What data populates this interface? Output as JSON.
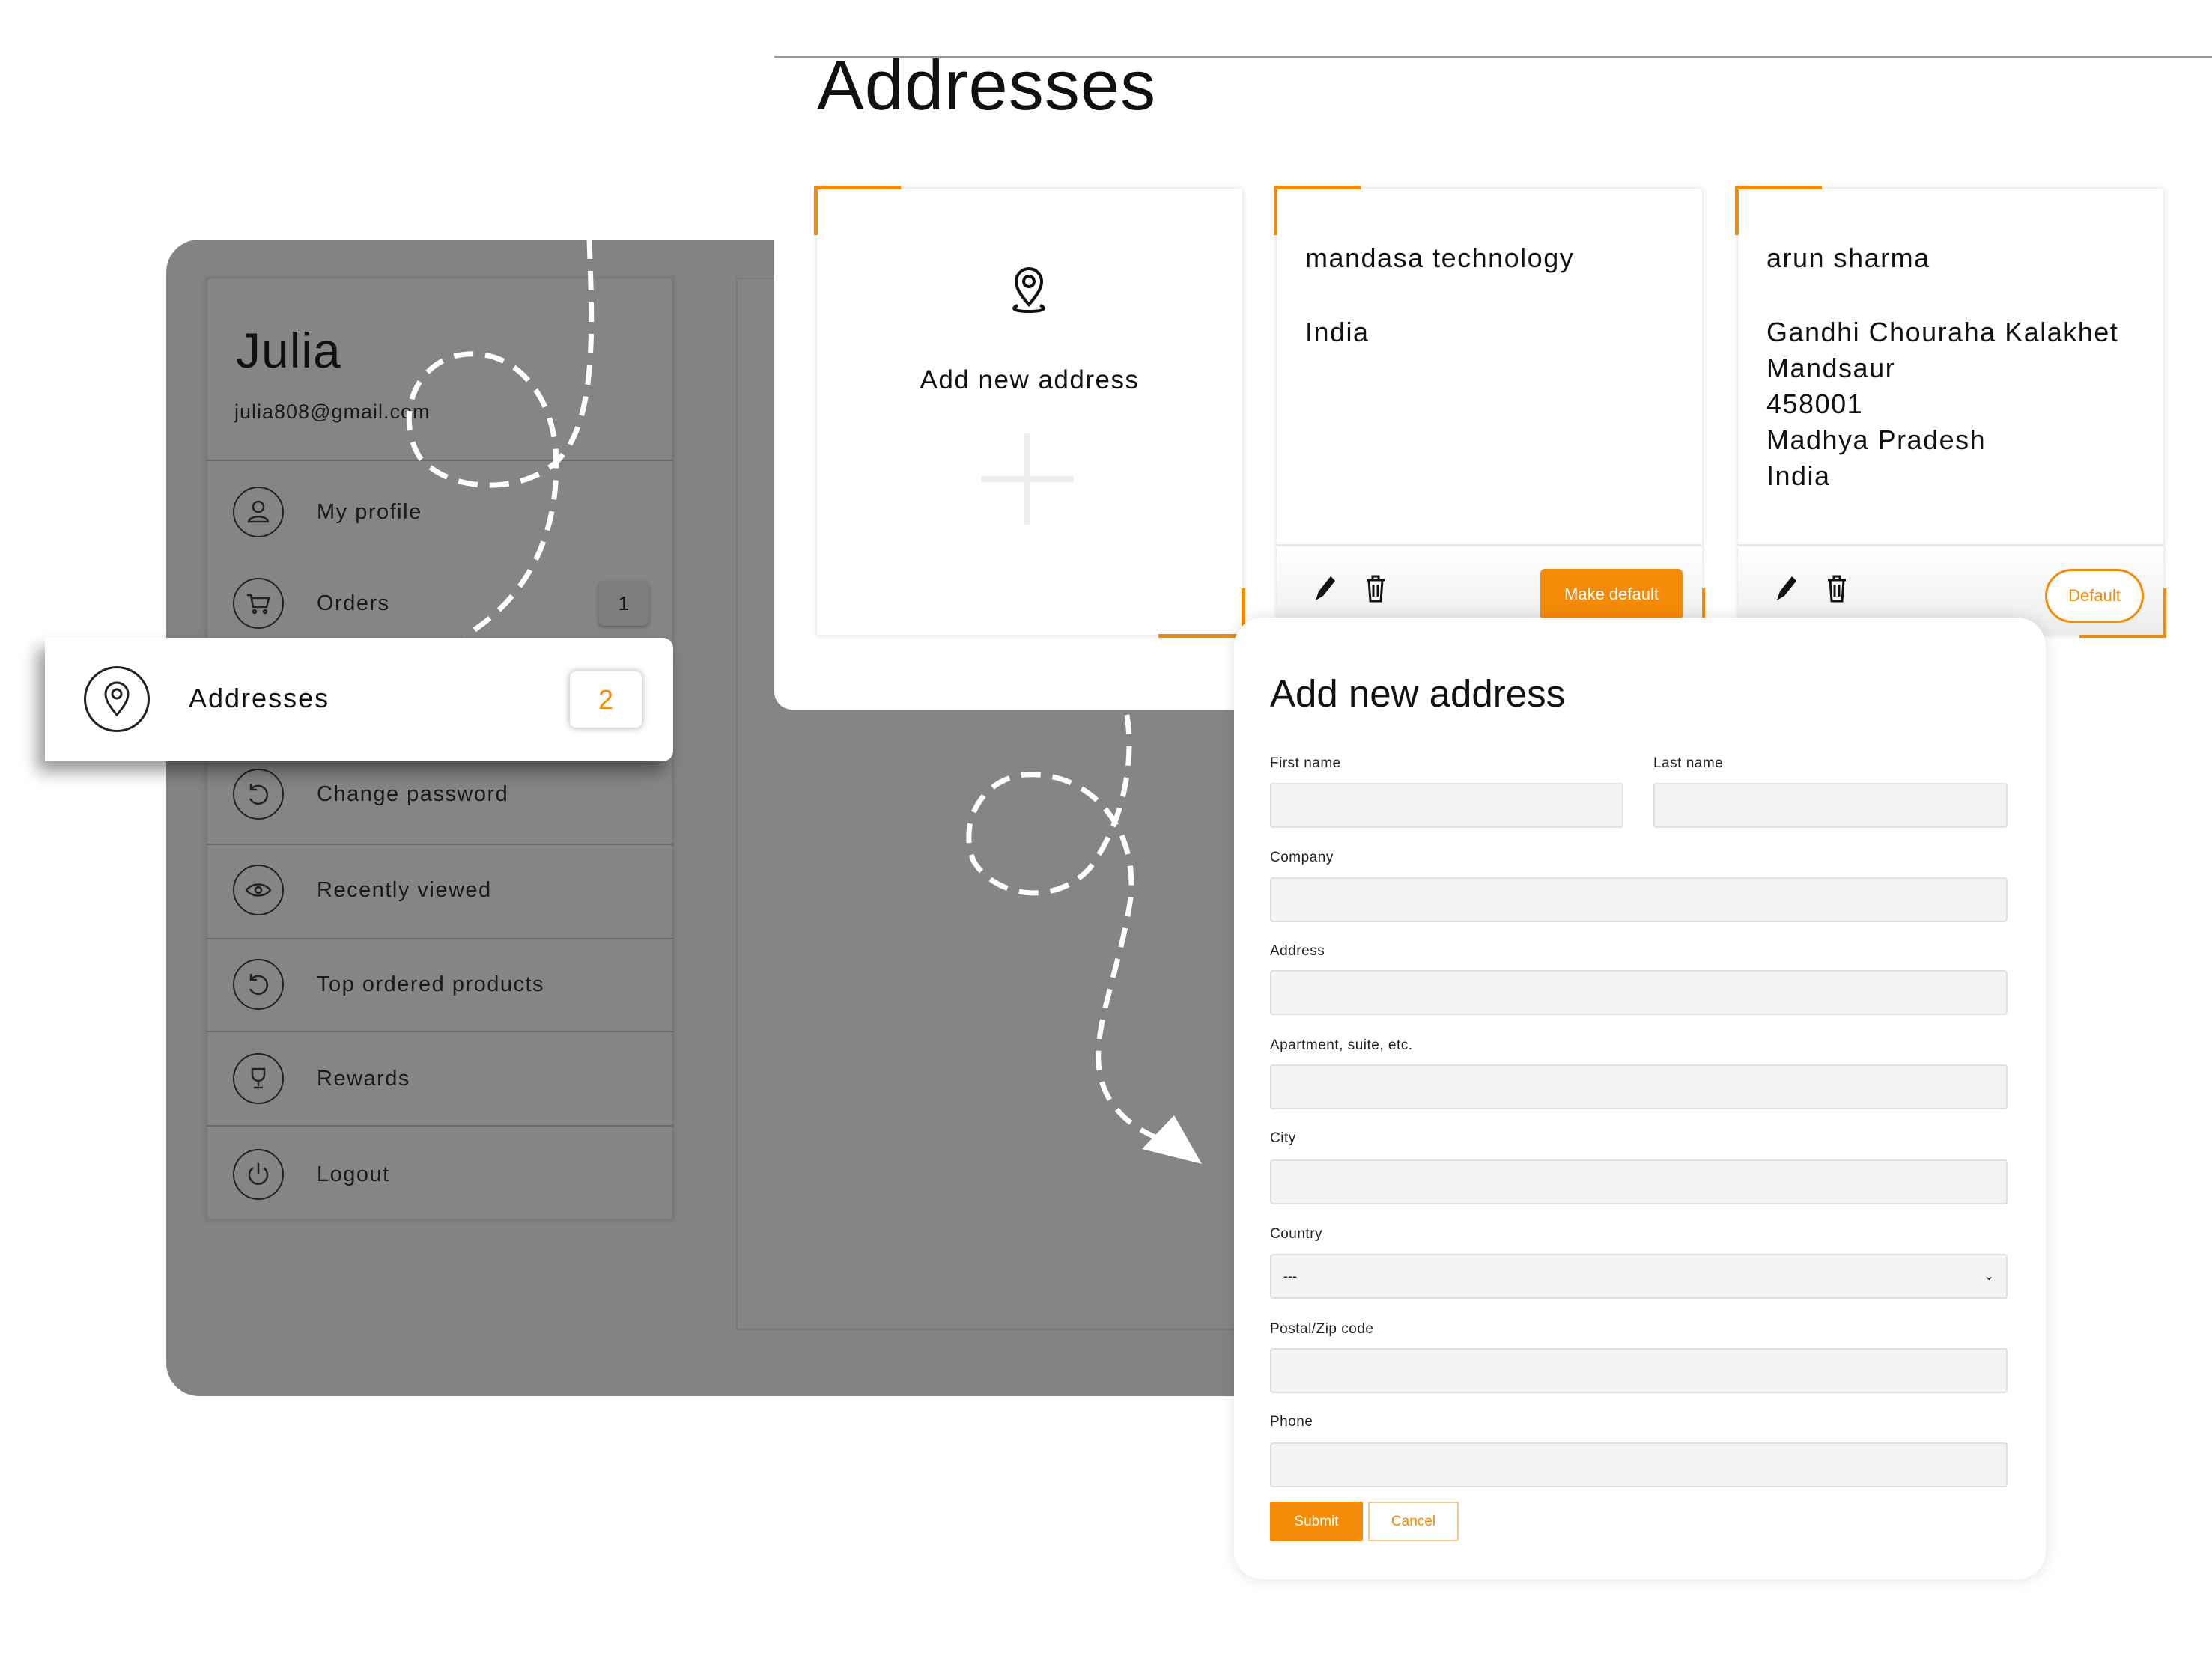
{
  "page": {
    "title": "Addresses"
  },
  "colors": {
    "accent": "#f58a07",
    "overlay": "#838383"
  },
  "profile": {
    "name": "Julia",
    "email": "julia808@gmail.com"
  },
  "sidebar": {
    "items": [
      {
        "label": "My profile",
        "icon": "user-icon"
      },
      {
        "label": "Orders",
        "icon": "cart-icon",
        "badge": "1"
      },
      {
        "label": "Addresses",
        "icon": "map-pin-icon",
        "badge": "2",
        "active": true
      },
      {
        "label": "Change password",
        "icon": "refresh-icon"
      },
      {
        "label": "Recently viewed",
        "icon": "eye-icon"
      },
      {
        "label": "Top ordered products",
        "icon": "refresh-icon"
      },
      {
        "label": "Rewards",
        "icon": "trophy-icon"
      },
      {
        "label": "Logout",
        "icon": "power-icon"
      }
    ]
  },
  "cards": {
    "add": {
      "label": "Add new address"
    },
    "addresses": [
      {
        "name": "mandasa technology",
        "lines": [
          "India"
        ],
        "action": "Make default"
      },
      {
        "name": "arun sharma",
        "lines": [
          "Gandhi Chouraha Kalakhet",
          "Mandsaur",
          "458001",
          "Madhya Pradesh",
          "India"
        ],
        "action": "Default"
      }
    ]
  },
  "form": {
    "title": "Add new address",
    "first_name": "First name",
    "last_name": "Last name",
    "company": "Company",
    "address": "Address",
    "apartment": "Apartment, suite, etc.",
    "city": "City",
    "country": "Country",
    "country_value": "---",
    "postal": "Postal/Zip code",
    "phone": "Phone",
    "submit": "Submit",
    "cancel": "Cancel"
  }
}
